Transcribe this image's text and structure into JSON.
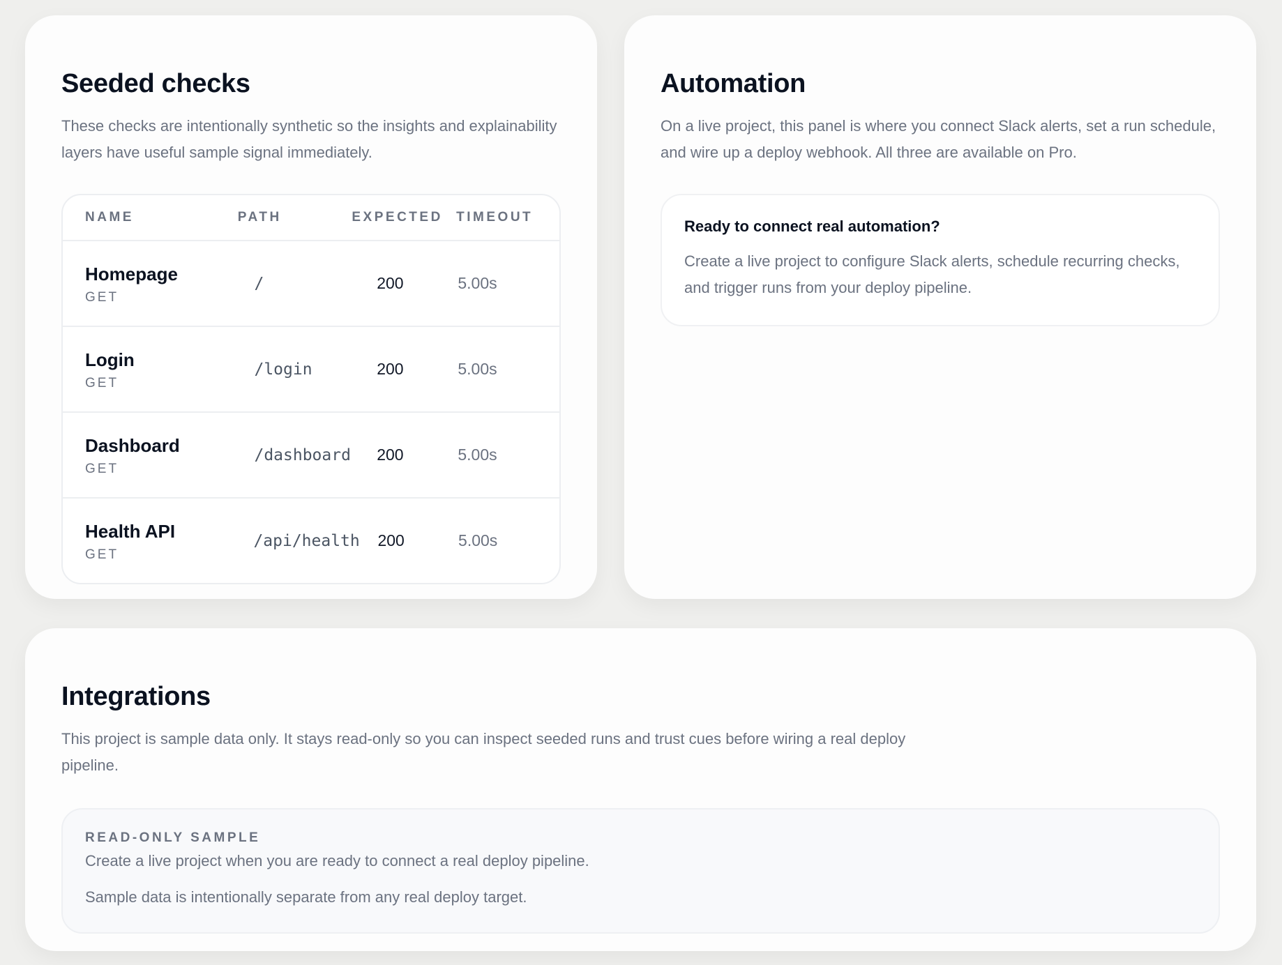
{
  "seeded": {
    "title": "Seeded checks",
    "description": "These checks are intentionally synthetic so the insights and explainability layers have useful sample signal immediately.",
    "columns": {
      "name": "NAME",
      "path": "PATH",
      "expected": "EXPECTED",
      "timeout": "TIMEOUT"
    },
    "rows": [
      {
        "name": "Homepage",
        "method": "GET",
        "path": "/",
        "expected": "200",
        "timeout": "5.00s"
      },
      {
        "name": "Login",
        "method": "GET",
        "path": "/login",
        "expected": "200",
        "timeout": "5.00s"
      },
      {
        "name": "Dashboard",
        "method": "GET",
        "path": "/dashboard",
        "expected": "200",
        "timeout": "5.00s"
      },
      {
        "name": "Health API",
        "method": "GET",
        "path": "/api/health",
        "expected": "200",
        "timeout": "5.00s"
      }
    ]
  },
  "automation": {
    "title": "Automation",
    "description": "On a live project, this panel is where you connect Slack alerts, set a run schedule, and wire up a deploy webhook. All three are available on Pro.",
    "callout": {
      "title": "Ready to connect real automation?",
      "text": "Create a live project to configure Slack alerts, schedule recurring checks, and trigger runs from your deploy pipeline."
    }
  },
  "integrations": {
    "title": "Integrations",
    "description": "This project is sample data only. It stays read-only so you can inspect seeded runs and trust cues before wiring a real deploy pipeline.",
    "notice": {
      "label": "READ-ONLY SAMPLE",
      "line1": "Create a live project when you are ready to connect a real deploy pipeline.",
      "line2": "Sample data is intentionally separate from any real deploy target."
    }
  }
}
